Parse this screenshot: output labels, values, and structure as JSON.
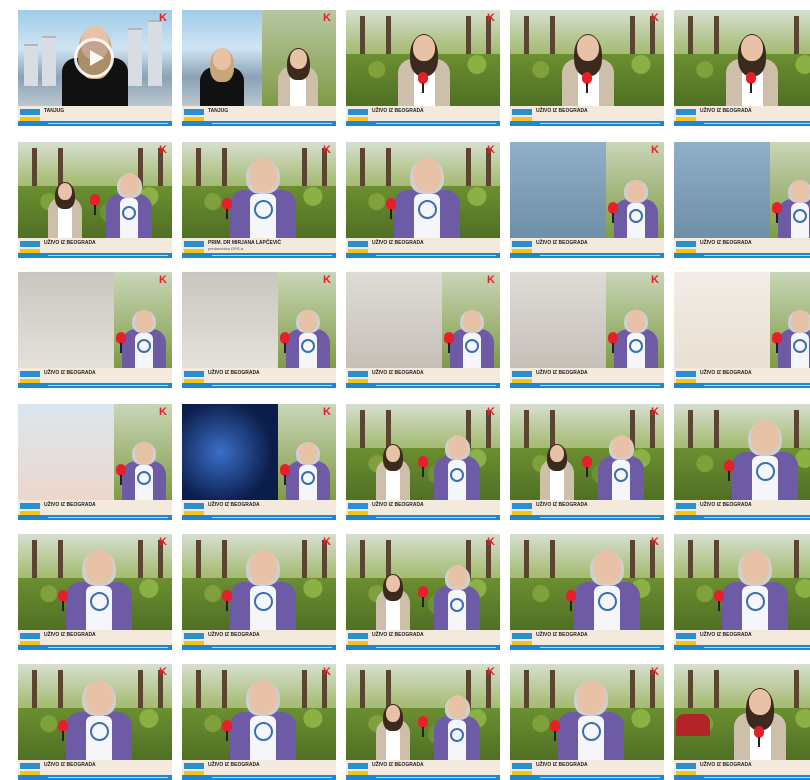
{
  "grid": {
    "thumbnails": [
      {
        "scene": "studio-anchor",
        "headline": "TANJUG",
        "subline": "",
        "badge": "",
        "play": true
      },
      {
        "scene": "studio-split",
        "headline": "TANJUG",
        "subline": "",
        "badge": ""
      },
      {
        "scene": "reporter",
        "headline": "UŽIVO IZ BEOGRADA",
        "subline": "",
        "badge": ""
      },
      {
        "scene": "reporter",
        "headline": "UŽIVO IZ BEOGRADA",
        "subline": "",
        "badge": ""
      },
      {
        "scene": "reporter",
        "headline": "UŽIVO IZ BEOGRADA",
        "subline": "",
        "badge": ""
      },
      {
        "scene": "interview-wide",
        "headline": "UŽIVO IZ BEOGRADA",
        "subline": "",
        "badge": ""
      },
      {
        "scene": "guest",
        "headline": "PRIM. DR MIRJANA LAPČEVIĆ",
        "subline": "predsednica ORS-a",
        "badge": ""
      },
      {
        "scene": "guest",
        "headline": "UŽIVO IZ BEOGRADA",
        "subline": "",
        "badge": ""
      },
      {
        "scene": "hands-split",
        "headline": "UŽIVO IZ BEOGRADA",
        "subline": "",
        "badge": ""
      },
      {
        "scene": "hands2-split",
        "headline": "UŽIVO IZ BEOGRADA",
        "subline": "",
        "badge": ""
      },
      {
        "scene": "clinic-split",
        "headline": "UŽIVO IZ BEOGRADA",
        "subline": "",
        "badge": ""
      },
      {
        "scene": "clinic2-split",
        "headline": "UŽIVO IZ BEOGRADA",
        "subline": "",
        "badge": ""
      },
      {
        "scene": "hall-split",
        "headline": "UŽIVO IZ BEOGRADA",
        "subline": "",
        "badge": ""
      },
      {
        "scene": "hall-split",
        "headline": "UŽIVO IZ BEOGRADA",
        "subline": "",
        "badge": ""
      },
      {
        "scene": "diagram-split",
        "headline": "UŽIVO IZ BEOGRADA",
        "subline": "",
        "badge": ""
      },
      {
        "scene": "knee-split",
        "headline": "UŽIVO IZ BEOGRADA",
        "subline": "",
        "badge": ""
      },
      {
        "scene": "xray-split",
        "headline": "UŽIVO IZ BEOGRADA",
        "subline": "",
        "badge": ""
      },
      {
        "scene": "interview",
        "headline": "UŽIVO IZ BEOGRADA",
        "subline": "",
        "badge": ""
      },
      {
        "scene": "interview",
        "headline": "UŽIVO IZ BEOGRADA",
        "subline": "",
        "badge": ""
      },
      {
        "scene": "guest-close",
        "headline": "UŽIVO IZ BEOGRADA",
        "subline": "",
        "badge": ""
      },
      {
        "scene": "guest",
        "headline": "UŽIVO IZ BEOGRADA",
        "subline": "",
        "badge": ""
      },
      {
        "scene": "guest",
        "headline": "UŽIVO IZ BEOGRADA",
        "subline": "",
        "badge": ""
      },
      {
        "scene": "interview",
        "headline": "UŽIVO IZ BEOGRADA",
        "subline": "",
        "badge": ""
      },
      {
        "scene": "guest-right",
        "headline": "UŽIVO IZ BEOGRADA",
        "subline": "",
        "badge": ""
      },
      {
        "scene": "guest",
        "headline": "UŽIVO IZ BEOGRADA",
        "subline": "",
        "badge": ""
      },
      {
        "scene": "guest",
        "headline": "UŽIVO IZ BEOGRADA",
        "subline": "",
        "badge": ""
      },
      {
        "scene": "guest",
        "headline": "UŽIVO IZ BEOGRADA",
        "subline": "",
        "badge": ""
      },
      {
        "scene": "interview",
        "headline": "UŽIVO IZ BEOGRADA",
        "subline": "",
        "badge": ""
      },
      {
        "scene": "guest",
        "headline": "UŽIVO IZ BEOGRADA",
        "subline": "",
        "badge": ""
      },
      {
        "scene": "reporter-street",
        "headline": "UŽIVO IZ BEOGRADA",
        "subline": "",
        "badge": ""
      }
    ]
  },
  "brand": {
    "logo_text": "K",
    "logo_color": "#e5202a",
    "ticker_color": "#1f87cf",
    "ticker_bg": "#f4e9dd",
    "tag_color": "#2a8fd0"
  }
}
